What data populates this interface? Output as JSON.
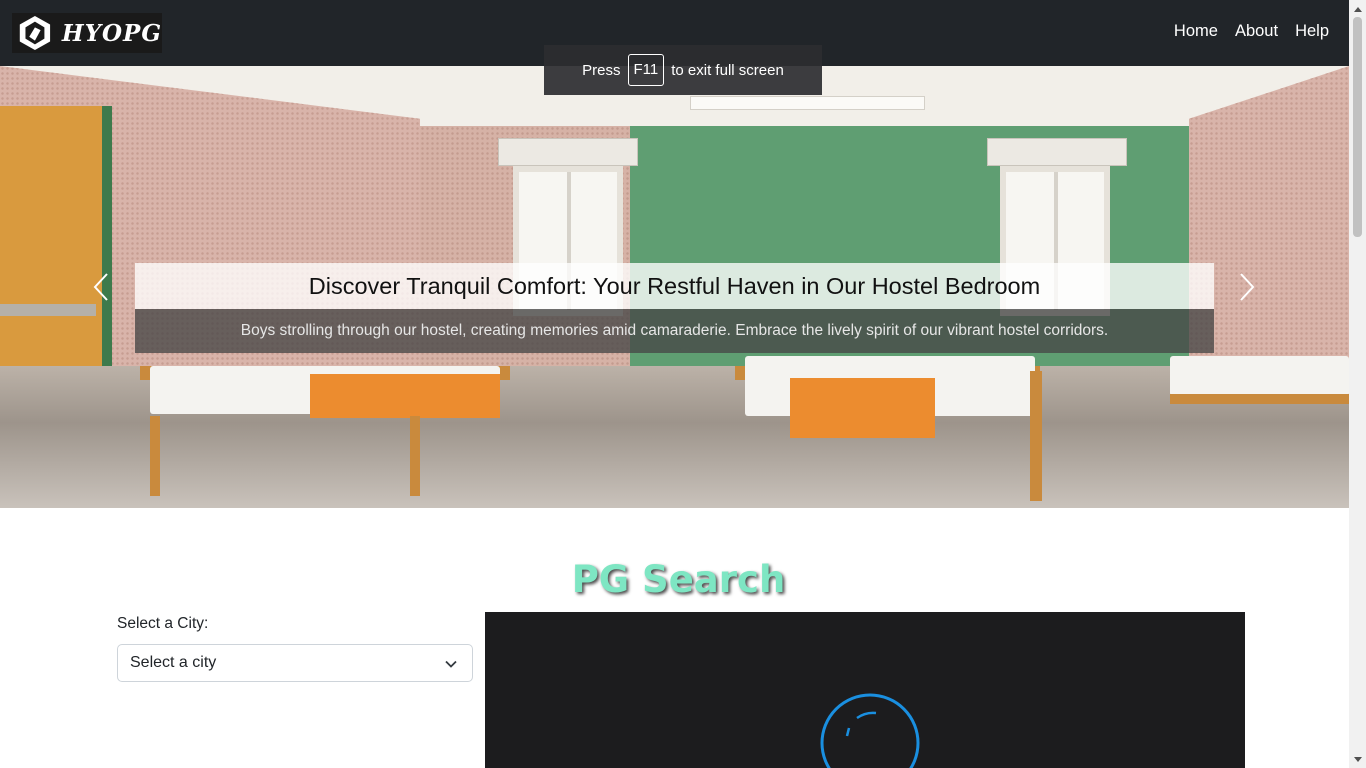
{
  "navbar": {
    "brand_text": "HYOPG",
    "links": [
      {
        "label": "Home"
      },
      {
        "label": "About"
      },
      {
        "label": "Help"
      }
    ]
  },
  "fullscreen_toast": {
    "prefix": "Press",
    "key": "F11",
    "suffix": "to exit full screen"
  },
  "carousel": {
    "title": "Discover Tranquil Comfort: Your Restful Haven in Our Hostel Bedroom",
    "subtitle": "Boys strolling through our hostel, creating memories amid camaraderie. Embrace the lively spirit of our vibrant hostel corridors.",
    "prev_icon": "chevron-left-icon",
    "next_icon": "chevron-right-icon"
  },
  "search": {
    "heading": "PG Search",
    "city_label": "Select a City:",
    "city_select_value": "Select a city"
  },
  "map": {
    "loading_icon": "spinner-icon"
  },
  "colors": {
    "navbar": "#212529",
    "heading": "#7ee6c3",
    "spinner": "#1a8fe0",
    "map_bg": "#1c1c1e"
  }
}
